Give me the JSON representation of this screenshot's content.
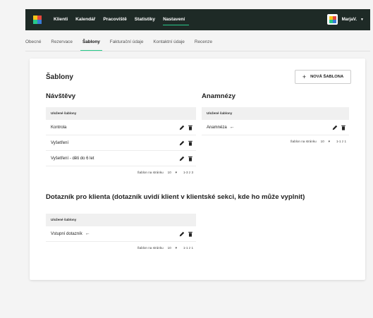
{
  "nav": {
    "items": [
      {
        "label": "Klienti",
        "active": false
      },
      {
        "label": "Kalendář",
        "active": false
      },
      {
        "label": "Pracoviště",
        "active": false
      },
      {
        "label": "Statistiky",
        "active": false
      },
      {
        "label": "Nastavení",
        "active": true
      }
    ],
    "user_label": "MarjaV."
  },
  "tabs": [
    {
      "label": "Obecné",
      "active": false
    },
    {
      "label": "Rezervace",
      "active": false
    },
    {
      "label": "Šablony",
      "active": true
    },
    {
      "label": "Fakturační údaje",
      "active": false
    },
    {
      "label": "Kontaktní údaje",
      "active": false
    },
    {
      "label": "Recenze",
      "active": false
    }
  ],
  "card": {
    "title": "Šablony",
    "new_button": "NOVÁ ŠABLONA"
  },
  "visits": {
    "title": "Návštěvy",
    "header": "Uložené šablony",
    "rows": [
      "Kontrola",
      "Vyšetření",
      "Vyšetření - děti do 6 let"
    ],
    "pager": {
      "label": "Šablon na stránku",
      "per_page": "10",
      "range": "1-3 z 3"
    }
  },
  "anamnesis": {
    "title": "Anamnézy",
    "header": "Uložené šablony",
    "rows": [
      "Anamnéza"
    ],
    "pager": {
      "label": "Šablon na stránku",
      "per_page": "10",
      "range": "1-1 z 1"
    }
  },
  "questionnaire": {
    "title": "Dotazník pro klienta (dotazník uvidí klient v klientské sekci, kde ho může vyplnit)",
    "header": "Uložené šablony",
    "rows": [
      "Vstupní dotazník"
    ],
    "pager": {
      "label": "Šablon na stránku",
      "per_page": "10",
      "range": "1-1 z 1"
    }
  },
  "icons": {
    "edit": "pencil-icon",
    "delete": "trash-icon",
    "default_marker": "arrow-left-icon",
    "dropdown": "caret-down-icon"
  },
  "colors": {
    "topbar": "#1e2a26",
    "accent": "#28c98a"
  }
}
